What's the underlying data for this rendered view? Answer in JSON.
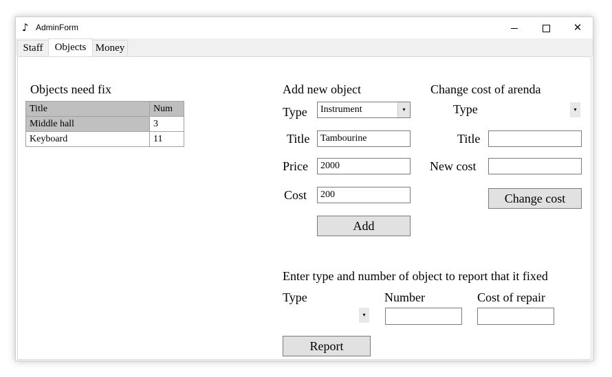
{
  "window": {
    "title": "AdminForm",
    "app_icon": "music-note-icon",
    "controls": {
      "minimize": "minimize-icon",
      "maximize": "maximize-icon",
      "close": "✕"
    }
  },
  "tabs": [
    {
      "label": "Staff"
    },
    {
      "label": "Objects"
    },
    {
      "label": "Money"
    }
  ],
  "objects_need_fix": {
    "heading": "Objects need fix",
    "columns": [
      "Title",
      "Num"
    ],
    "rows": [
      {
        "title": "Middle hall",
        "num": "3"
      },
      {
        "title": "Keyboard",
        "num": "11"
      }
    ]
  },
  "add_object": {
    "heading": "Add new object",
    "type_label": "Type",
    "type_value": "Instrument",
    "title_label": "Title",
    "title_value": "Tambourine",
    "price_label": "Price",
    "price_value": "2000",
    "cost_label": "Cost",
    "cost_value": "200",
    "add_button": "Add"
  },
  "change_cost": {
    "heading": "Change cost of arenda",
    "type_label": "Type",
    "title_label": "Title",
    "title_value": "",
    "new_cost_label": "New cost",
    "new_cost_value": "",
    "button": "Change cost"
  },
  "report": {
    "heading": "Enter type and number of object to report that it fixed",
    "type_label": "Type",
    "number_label": "Number",
    "number_value": "",
    "cost_label": "Cost of repair",
    "cost_value": "",
    "button": "Report"
  },
  "dropdown_arrow": "▾"
}
